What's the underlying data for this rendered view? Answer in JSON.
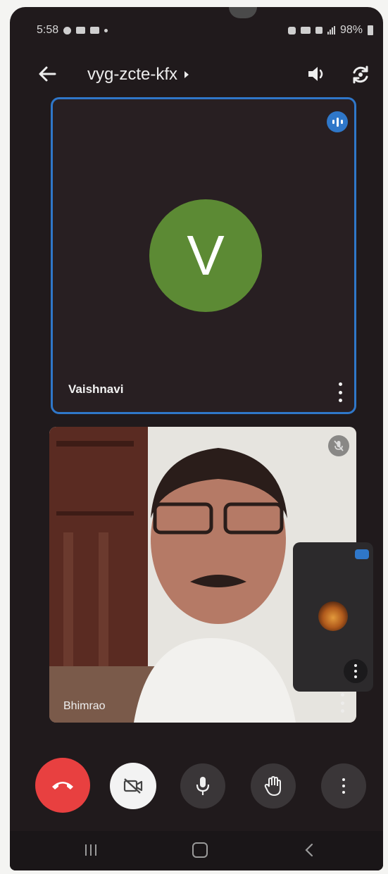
{
  "status_bar": {
    "time": "5:58",
    "battery": "98%"
  },
  "top_bar": {
    "meeting_code": "vyg-zcte-kfx"
  },
  "tiles": [
    {
      "name": "Vaishnavi",
      "avatar_letter": "V",
      "avatar_color": "#5c8a34",
      "speaking": true
    },
    {
      "name": "Bhimrao",
      "muted": true
    }
  ],
  "colors": {
    "active_speaker_border": "#2f77c9",
    "end_call": "#e84040",
    "background": "#201a1c"
  },
  "controls": {
    "icons": [
      "end-call-icon",
      "camera-off-icon",
      "mic-icon",
      "raise-hand-icon",
      "more-vertical-icon"
    ]
  },
  "nav": {
    "icons": [
      "recents-icon",
      "home-icon",
      "back-icon"
    ]
  }
}
